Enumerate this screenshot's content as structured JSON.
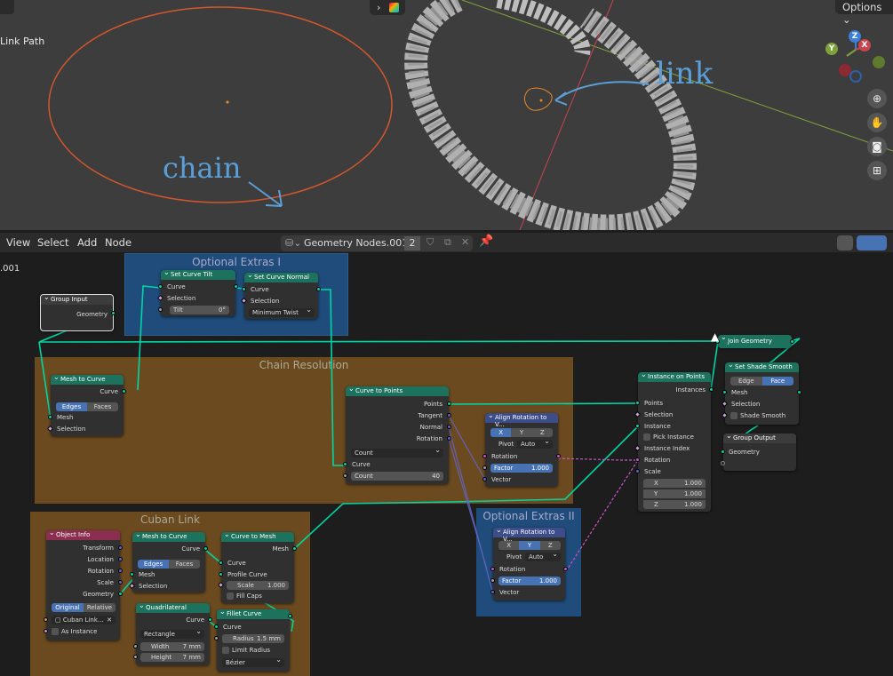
{
  "viewport": {
    "object_label": "Link Path",
    "options_label": "Options",
    "annotation_chain": "chain",
    "annotation_link": "link",
    "gizmo": {
      "z": "Z",
      "y": "Y",
      "x": "X"
    },
    "colors": {
      "curve": "#d5562c",
      "x_axis": "#c8444f",
      "y_axis": "#7da23a",
      "chain": "#bdbdbd"
    }
  },
  "node_editor": {
    "menu": [
      "View",
      "Select",
      "Add",
      "Node"
    ],
    "tree_name": "Geometry Nodes.001",
    "users": "2",
    "side_label": ".001"
  },
  "frames": {
    "optional_1": "Optional Extras I",
    "chain_resolution": "Chain Resolution",
    "cuban_link": "Cuban Link",
    "optional_2": "Optional Extras II"
  },
  "nodes": {
    "group_input": {
      "title": "Group Input",
      "geometry": "Geometry"
    },
    "set_curve_tilt": {
      "title": "Set Curve Tilt",
      "curve": "Curve",
      "selection": "Selection",
      "tilt_label": "Tilt",
      "tilt_value": "0°"
    },
    "set_curve_normal": {
      "title": "Set Curve Normal",
      "curve": "Curve",
      "selection": "Selection",
      "mode": "Minimum Twist"
    },
    "mesh_to_curve_1": {
      "title": "Mesh to Curve",
      "curve": "Curve",
      "edges": "Edges",
      "faces": "Faces",
      "mesh": "Mesh",
      "selection": "Selection"
    },
    "curve_to_points": {
      "title": "Curve to Points",
      "points": "Points",
      "tangent": "Tangent",
      "normal": "Normal",
      "rotation": "Rotation",
      "mode": "Count",
      "curve": "Curve",
      "count_label": "Count",
      "count_value": "40"
    },
    "align_rot_1": {
      "title": "Align Rotation to V...",
      "x": "X",
      "y": "Y",
      "z": "Z",
      "pivot_label": "Pivot",
      "pivot_value": "Auto",
      "rotation": "Rotation",
      "factor_label": "Factor",
      "factor_value": "1.000",
      "vector": "Vector"
    },
    "instance_on_points": {
      "title": "Instance on Points",
      "instances": "Instances",
      "points": "Points",
      "selection": "Selection",
      "instance": "Instance",
      "pick_instance": "Pick Instance",
      "instance_index": "Instance Index",
      "rotation": "Rotation",
      "scale": "Scale",
      "sx_label": "X",
      "sx": "1.000",
      "sy_label": "Y",
      "sy": "1.000",
      "sz_label": "Z",
      "sz": "1.000"
    },
    "join_geometry": {
      "title": "Join Geometry"
    },
    "set_shade_smooth": {
      "title": "Set Shade Smooth",
      "edge": "Edge",
      "face": "Face",
      "mesh": "Mesh",
      "selection": "Selection",
      "shade_smooth": "Shade Smooth"
    },
    "group_output": {
      "title": "Group Output",
      "geometry": "Geometry"
    },
    "object_info": {
      "title": "Object Info",
      "transform": "Transform",
      "location": "Location",
      "rotation": "Rotation",
      "scale": "Scale",
      "geometry": "Geometry",
      "original": "Original",
      "relative": "Relative",
      "object": "Cuban Link...",
      "as_instance": "As Instance"
    },
    "mesh_to_curve_2": {
      "title": "Mesh to Curve",
      "curve": "Curve",
      "edges": "Edges",
      "faces": "Faces",
      "mesh": "Mesh",
      "selection": "Selection"
    },
    "curve_to_mesh": {
      "title": "Curve to Mesh",
      "mesh": "Mesh",
      "curve": "Curve",
      "profile": "Profile Curve",
      "scale_label": "Scale",
      "scale_value": "1.000",
      "fill_caps": "Fill Caps"
    },
    "quadrilateral": {
      "title": "Quadrilateral",
      "curve": "Curve",
      "mode": "Rectangle",
      "width_label": "Width",
      "width_value": "7 mm",
      "height_label": "Height",
      "height_value": "7 mm"
    },
    "fillet_curve": {
      "title": "Fillet Curve",
      "curve": "Curve",
      "radius_label": "Radius",
      "radius_value": "1.5 mm",
      "limit_radius": "Limit Radius",
      "mode": "Bézier"
    },
    "align_rot_2": {
      "title": "Align Rotation to V...",
      "x": "X",
      "y": "Y",
      "z": "Z",
      "pivot_label": "Pivot",
      "pivot_value": "Auto",
      "rotation": "Rotation",
      "factor_label": "Factor",
      "factor_value": "1.000",
      "vector": "Vector"
    }
  }
}
